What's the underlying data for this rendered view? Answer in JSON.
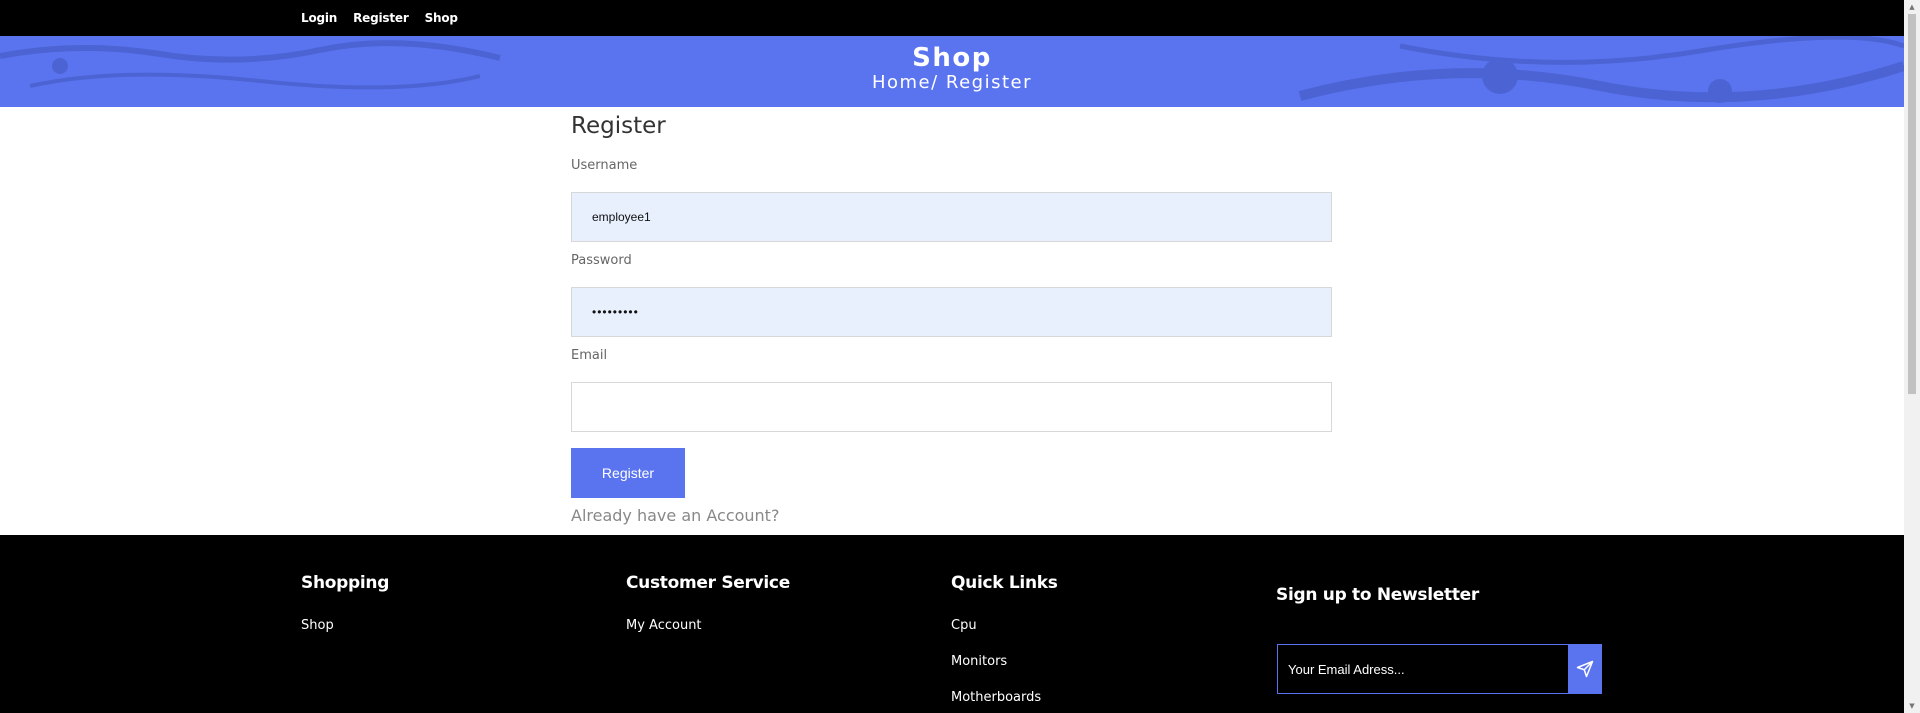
{
  "nav": {
    "items": [
      "Login",
      "Register",
      "Shop"
    ]
  },
  "hero": {
    "title": "Shop",
    "breadcrumb": "Home/ Register"
  },
  "form": {
    "title": "Register",
    "username_label": "Username",
    "username_value": "employee1",
    "password_label": "Password",
    "password_value": "•••••••••",
    "email_label": "Email",
    "email_value": "",
    "submit_label": "Register",
    "already_text": "Already have an Account?"
  },
  "footer": {
    "shopping": {
      "title": "Shopping",
      "links": [
        "Shop"
      ]
    },
    "customer_service": {
      "title": "Customer Service",
      "links": [
        "My Account"
      ]
    },
    "quick_links": {
      "title": "Quick Links",
      "links": [
        "Cpu",
        "Monitors",
        "Motherboards"
      ]
    },
    "newsletter": {
      "title": "Sign up to Newsletter",
      "placeholder": "Your Email Adress..."
    }
  },
  "colors": {
    "accent": "#5a74f0",
    "black": "#000000",
    "autofill": "#e8f0fe"
  },
  "icons": {
    "newsletter_send": "send-icon"
  }
}
